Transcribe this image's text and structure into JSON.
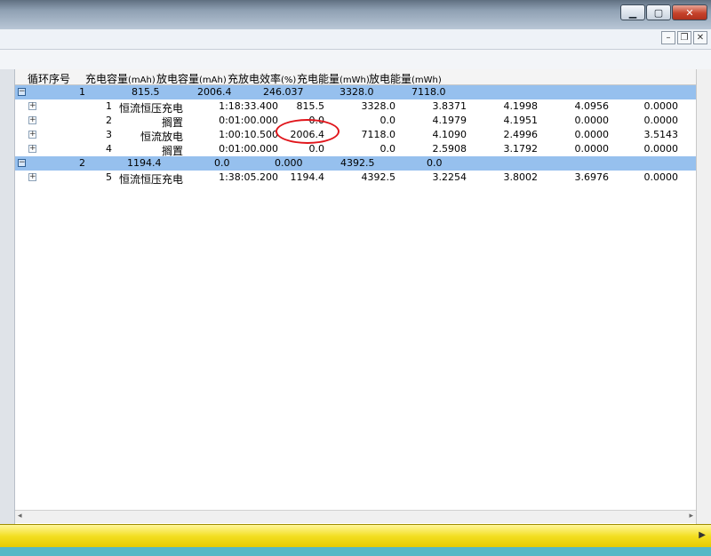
{
  "window": {
    "minimize_icon": "minimize-icon",
    "maximize_icon": "maximize-icon",
    "close_label": "✕"
  },
  "mdi": {
    "minimize_label": "–",
    "restore_label": "❐",
    "close_label": "✕"
  },
  "columns": [
    {
      "text": "循环序号",
      "unit": ""
    },
    {
      "text": "充电容量",
      "unit": "(mAh)"
    },
    {
      "text": "放电容量",
      "unit": "(mAh)"
    },
    {
      "text": "充放电效率",
      "unit": "(%)"
    },
    {
      "text": "充电能量",
      "unit": "(mWh)"
    },
    {
      "text": "放电能量",
      "unit": "(mWh)"
    }
  ],
  "groups": [
    {
      "expander": "−",
      "cycle": "1",
      "charge_cap": "815.5",
      "discharge_cap": "2006.4",
      "efficiency": "246.037",
      "charge_energy": "3328.0",
      "discharge_energy": "7118.0"
    },
    {
      "expander": "−",
      "cycle": "2",
      "charge_cap": "1194.4",
      "discharge_cap": "0.0",
      "efficiency": "0.000",
      "charge_energy": "4392.5",
      "discharge_energy": "0.0"
    }
  ],
  "steps": [
    {
      "expander": "+",
      "index": "1",
      "name": "恒流恒压充电",
      "time": "1:18:33.400",
      "capacity": "815.5",
      "energy": "3328.0",
      "v1": "3.8371",
      "v2": "4.1998",
      "v3": "4.0956",
      "v4": "0.0000"
    },
    {
      "expander": "+",
      "index": "2",
      "name": "搁置",
      "time": "0:01:00.000",
      "capacity": "0.0",
      "energy": "0.0",
      "v1": "4.1979",
      "v2": "4.1951",
      "v3": "0.0000",
      "v4": "0.0000"
    },
    {
      "expander": "+",
      "index": "3",
      "name": "恒流放电",
      "time": "1:00:10.500",
      "capacity": "2006.4",
      "energy": "7118.0",
      "v1": "4.1090",
      "v2": "2.4996",
      "v3": "0.0000",
      "v4": "3.5143"
    },
    {
      "expander": "+",
      "index": "4",
      "name": "搁置",
      "time": "0:01:00.000",
      "capacity": "0.0",
      "energy": "0.0",
      "v1": "2.5908",
      "v2": "3.1792",
      "v3": "0.0000",
      "v4": "0.0000"
    },
    {
      "expander": "+",
      "index": "5",
      "name": "恒流恒压充电",
      "time": "1:38:05.200",
      "capacity": "1194.4",
      "energy": "4392.5",
      "v1": "3.2254",
      "v2": "3.8002",
      "v3": "3.6976",
      "v4": "0.0000"
    }
  ],
  "scroll": {
    "left": "◂",
    "right": "▸",
    "yellow_right": "▶"
  },
  "colors": {
    "group_row": "#96c0ee",
    "annotation": "#e0151b",
    "status_bar": "#f3de20"
  }
}
